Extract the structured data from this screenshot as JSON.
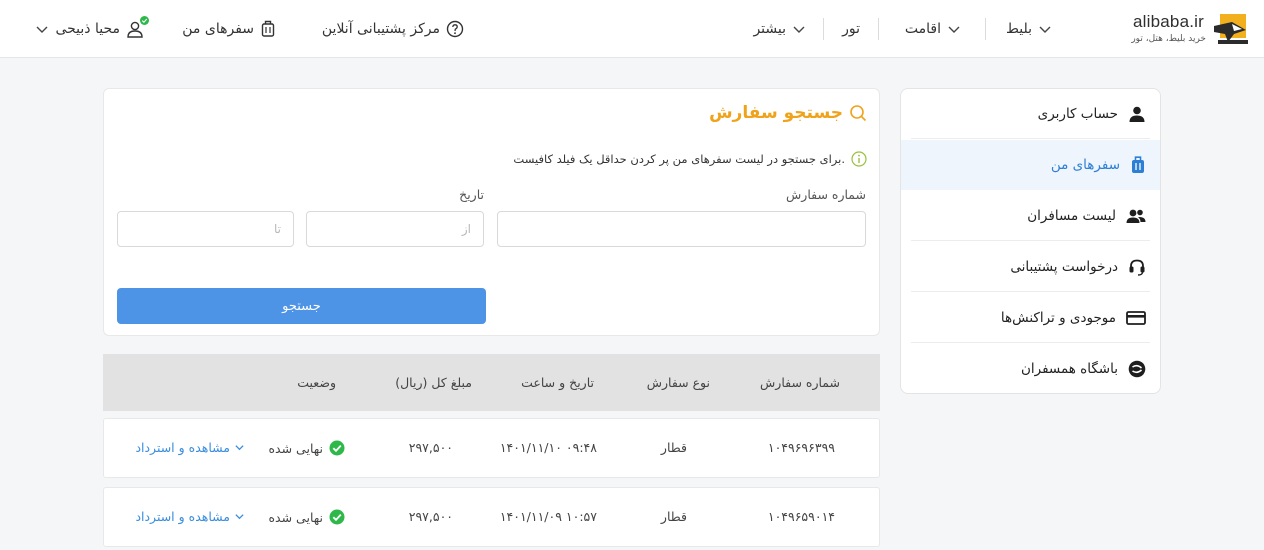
{
  "brand": {
    "name": "alibaba.ir",
    "tagline": "خرید بلیط، هتل، تور",
    "colors": {
      "accent": "#f0a31a",
      "primary": "#4d93e6",
      "success": "#2fb84a"
    }
  },
  "header": {
    "nav": {
      "ticket": "بلیط",
      "stay": "اقامت",
      "tour": "تور",
      "more": "بیشتر"
    },
    "support_label": "مرکز پشتیبانی آنلاین",
    "trips_label": "سفرهای من",
    "user_name": "محیا ذبیحی"
  },
  "sidebar": {
    "items": [
      {
        "label": "حساب کاربری",
        "icon": "user-icon"
      },
      {
        "label": "سفرهای من",
        "icon": "suitcase-icon",
        "active": true
      },
      {
        "label": "لیست مسافران",
        "icon": "users-icon"
      },
      {
        "label": "درخواست پشتیبانی",
        "icon": "headset-icon"
      },
      {
        "label": "موجودی و تراکنش‌ها",
        "icon": "card-icon"
      },
      {
        "label": "باشگاه همسفران",
        "icon": "club-icon"
      }
    ]
  },
  "search": {
    "title": "جستجو سفارش",
    "info": "برای جستجو در لیست سفرهای من پر کردن حداقل یک فیلد کافیست.",
    "order_label": "شماره سفارش",
    "order_value": "",
    "date_label": "تاریخ",
    "from_placeholder": "از",
    "to_placeholder": "تا",
    "button_label": "جستجو"
  },
  "table": {
    "headers": {
      "order_number": "شماره سفارش",
      "order_type": "نوع سفارش",
      "datetime": "تاریخ و ساعت",
      "total": "مبلغ کل (ریال)",
      "status": "وضعیت"
    },
    "rows": [
      {
        "order_number": "۱۰۴۹۶۹۶۳۹۹",
        "order_type": "قطار",
        "datetime": "۱۴۰۱/۱۱/۱۰  ۰۹:۴۸",
        "total": "۲۹۷,۵۰۰",
        "status": "نهایی شده",
        "action": "مشاهده و استرداد"
      },
      {
        "order_number": "۱۰۴۹۶۵۹۰۱۴",
        "order_type": "قطار",
        "datetime": "۱۴۰۱/۱۱/۰۹  ۱۰:۵۷",
        "total": "۲۹۷,۵۰۰",
        "status": "نهایی شده",
        "action": "مشاهده و استرداد"
      }
    ]
  }
}
